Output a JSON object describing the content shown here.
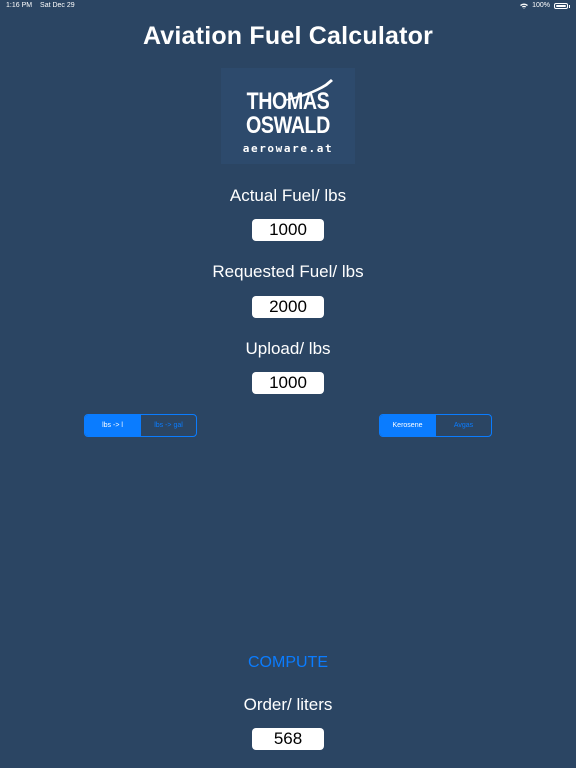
{
  "status_bar": {
    "time": "1:16 PM",
    "date": "Sat Dec 29",
    "battery": "100%"
  },
  "app": {
    "title": "Aviation Fuel Calculator"
  },
  "logo": {
    "line1": "THOMAS",
    "line2": "OSWALD",
    "line3": "aeroware.at"
  },
  "fields": {
    "actual": {
      "label": "Actual Fuel/ lbs",
      "value": "1000"
    },
    "requested": {
      "label": "Requested Fuel/ lbs",
      "value": "2000"
    },
    "upload": {
      "label": "Upload/ lbs",
      "value": "1000"
    }
  },
  "unit_toggle": {
    "options": [
      "lbs -> l",
      "lbs -> gal"
    ],
    "selected": "lbs -> l"
  },
  "fuel_toggle": {
    "options": [
      "Kerosene",
      "Avgas"
    ],
    "selected": "Kerosene"
  },
  "compute": {
    "label": "COMPUTE"
  },
  "order": {
    "label": "Order/ liters",
    "value": "568"
  },
  "colors": {
    "background": "#2b4563",
    "accent": "#0a7cff",
    "field": "#ffffff"
  }
}
